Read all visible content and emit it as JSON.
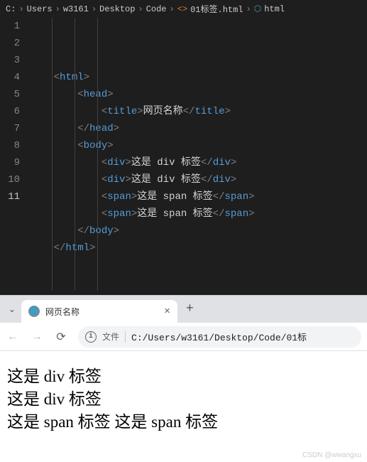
{
  "breadcrumb": {
    "parts": [
      "C:",
      "Users",
      "w3161",
      "Desktop",
      "Code"
    ],
    "file": "01标签.html",
    "element": "html"
  },
  "code": {
    "lines": [
      {
        "n": "1",
        "indent": 0,
        "open": "html",
        "close": "",
        "text": ""
      },
      {
        "n": "2",
        "indent": 1,
        "open": "head",
        "close": "",
        "text": ""
      },
      {
        "n": "3",
        "indent": 2,
        "open": "title",
        "close": "title",
        "text": "网页名称"
      },
      {
        "n": "4",
        "indent": 1,
        "open": "",
        "close": "head",
        "text": ""
      },
      {
        "n": "5",
        "indent": 1,
        "open": "body",
        "close": "",
        "text": ""
      },
      {
        "n": "6",
        "indent": 2,
        "open": "div",
        "close": "div",
        "text": "这是 div 标签"
      },
      {
        "n": "7",
        "indent": 2,
        "open": "div",
        "close": "div",
        "text": "这是 div 标签"
      },
      {
        "n": "8",
        "indent": 2,
        "open": "span",
        "close": "span",
        "text": "这是 span 标签"
      },
      {
        "n": "9",
        "indent": 2,
        "open": "span",
        "close": "span",
        "text": "这是 span 标签"
      },
      {
        "n": "10",
        "indent": 1,
        "open": "",
        "close": "body",
        "text": ""
      },
      {
        "n": "11",
        "indent": 0,
        "open": "",
        "close": "html",
        "text": ""
      }
    ],
    "current_line": 11
  },
  "browser": {
    "tab_title": "网页名称",
    "file_label": "文件",
    "url": "C:/Users/w3161/Desktop/Code/01标"
  },
  "page": {
    "line1": "这是 div 标签",
    "line2": "这是 div 标签",
    "span1": "这是 span 标签",
    "span2": "这是 span 标签"
  },
  "watermark": "CSDN @wwangxu"
}
